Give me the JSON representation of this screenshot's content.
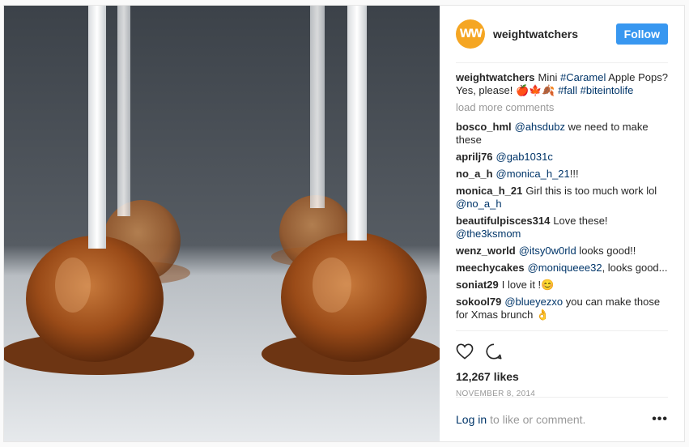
{
  "post": {
    "username": "weightwatchers",
    "avatar_text": "WW",
    "follow_label": "Follow",
    "caption": {
      "user": "weightwatchers",
      "parts": [
        {
          "text": "Mini ",
          "tag": false
        },
        {
          "text": "#Caramel",
          "tag": true
        },
        {
          "text": " Apple Pops? Yes, please! 🍎🍁🍂 ",
          "tag": false
        },
        {
          "text": "#fall",
          "tag": true
        },
        {
          "text": " ",
          "tag": false
        },
        {
          "text": "#biteintolife",
          "tag": true
        }
      ]
    },
    "load_more": "load more comments",
    "comments": [
      {
        "user": "bosco_hml",
        "mention": "@ahsdubz",
        "text": " we need to make these"
      },
      {
        "user": "aprilj76",
        "mention": "@gab1031c",
        "text": ""
      },
      {
        "user": "no_a_h",
        "mention": "@monica_h_21",
        "text": "!!!"
      },
      {
        "user": "monica_h_21",
        "mention": "",
        "text": "Girl this is too much work lol ",
        "mention_after": "@no_a_h"
      },
      {
        "user": "beautifulpisces314",
        "mention": "",
        "text": "Love these! ",
        "mention_after": "@the3ksmom"
      },
      {
        "user": "wenz_world",
        "mention": "@itsy0w0rld",
        "text": " looks good!!"
      },
      {
        "user": "meechycakes",
        "mention": "@moniqueee32",
        "text": ", looks good..."
      },
      {
        "user": "soniat29",
        "mention": "",
        "text": "I love it !😊"
      },
      {
        "user": "sokool79",
        "mention": "@blueyezxo",
        "text": " you can make those for Xmas brunch 👌"
      }
    ],
    "likes": "12,267 likes",
    "date": "NOVEMBER 8, 2014",
    "footer": {
      "login": "Log in",
      "rest": "to like or comment.",
      "more": "•••"
    }
  },
  "icons": [
    "heart-icon",
    "comment-icon",
    "more-options-icon"
  ],
  "colors": {
    "accent": "#3897f0",
    "link": "#003569",
    "muted": "#999999",
    "caramel": "#a2531b"
  }
}
